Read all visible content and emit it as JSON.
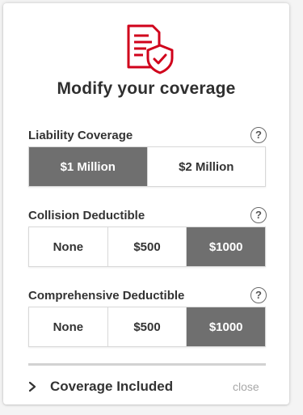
{
  "header": {
    "icon": "policy-shield-check-icon",
    "title": "Modify your coverage"
  },
  "colors": {
    "accent": "#d0021b",
    "selected_bg": "#6f6f6f",
    "text": "#333333",
    "muted": "#a8a8a8"
  },
  "liability": {
    "label": "Liability Coverage",
    "help": "?",
    "options": [
      "$1 Million",
      "$2 Million"
    ],
    "selected": "$1 Million"
  },
  "collision": {
    "label": "Collision Deductible",
    "help": "?",
    "options": [
      "None",
      "$500",
      "$1000"
    ],
    "selected": "$1000"
  },
  "comprehensive": {
    "label": "Comprehensive Deductible",
    "help": "?",
    "options": [
      "None",
      "$500",
      "$1000"
    ],
    "selected": "$1000"
  },
  "footer": {
    "toggle_label": "Coverage Included",
    "chevron_icon": "chevron-right-icon",
    "close_label": "close"
  }
}
